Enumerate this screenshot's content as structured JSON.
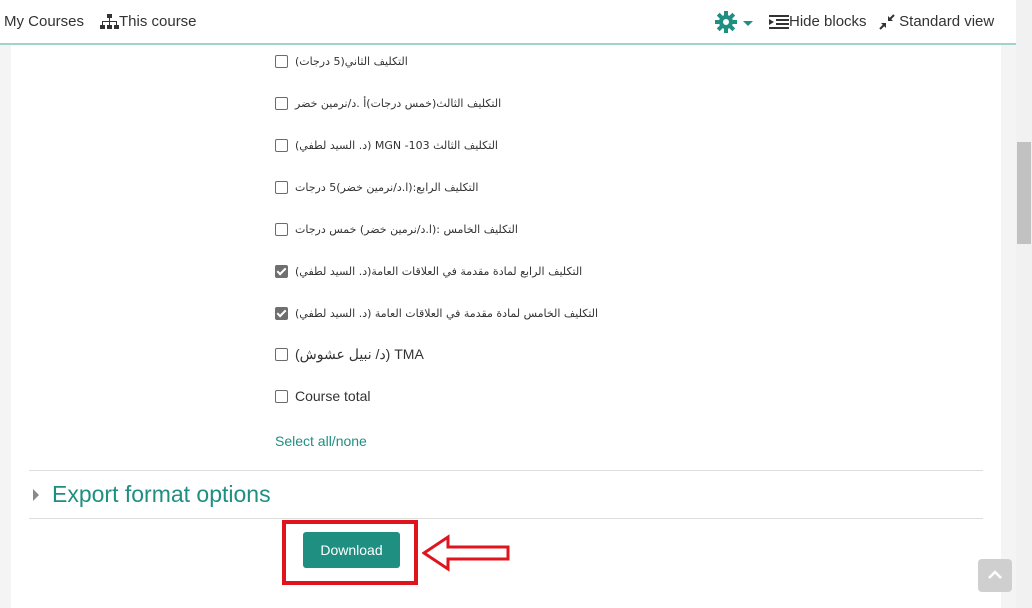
{
  "nav": {
    "my_courses": "My Courses",
    "this_course": "This course",
    "hide_blocks": "Hide blocks",
    "standard_view": "Standard view"
  },
  "items": [
    {
      "label": "التكليف الثاني(5 درجات)",
      "checked": false,
      "big": false
    },
    {
      "label": "التكليف الثالث(خمس درجات)أ .د/نرمين خضر",
      "checked": false,
      "big": false
    },
    {
      "label": "التكليف الثالث MGN -103 (د. السيد لطفي)",
      "checked": false,
      "big": false
    },
    {
      "label": "التكليف الرابع:(ا.د/نرمين خضر)5 درجات",
      "checked": false,
      "big": false
    },
    {
      "label": "التكليف الخامس :(ا.د/نرمين خضر) خمس درجات",
      "checked": false,
      "big": false
    },
    {
      "label": "التكليف الرابع لمادة مقدمة في العلاقات العامة(د. السيد لطفي)",
      "checked": true,
      "big": false
    },
    {
      "label": "التكليف الخامس لمادة مقدمة في العلاقات العامة (د. السيد لطفي)",
      "checked": true,
      "big": false
    },
    {
      "label": "TMA (د/ نبيل عشوش)",
      "checked": false,
      "big": false
    },
    {
      "label": "Course total",
      "checked": false,
      "big": true
    }
  ],
  "select_all": "Select all/none",
  "export_section": {
    "title": "Export format options"
  },
  "download_label": "Download",
  "colors": {
    "accent": "#1f8f82",
    "highlight": "#e0141d"
  }
}
